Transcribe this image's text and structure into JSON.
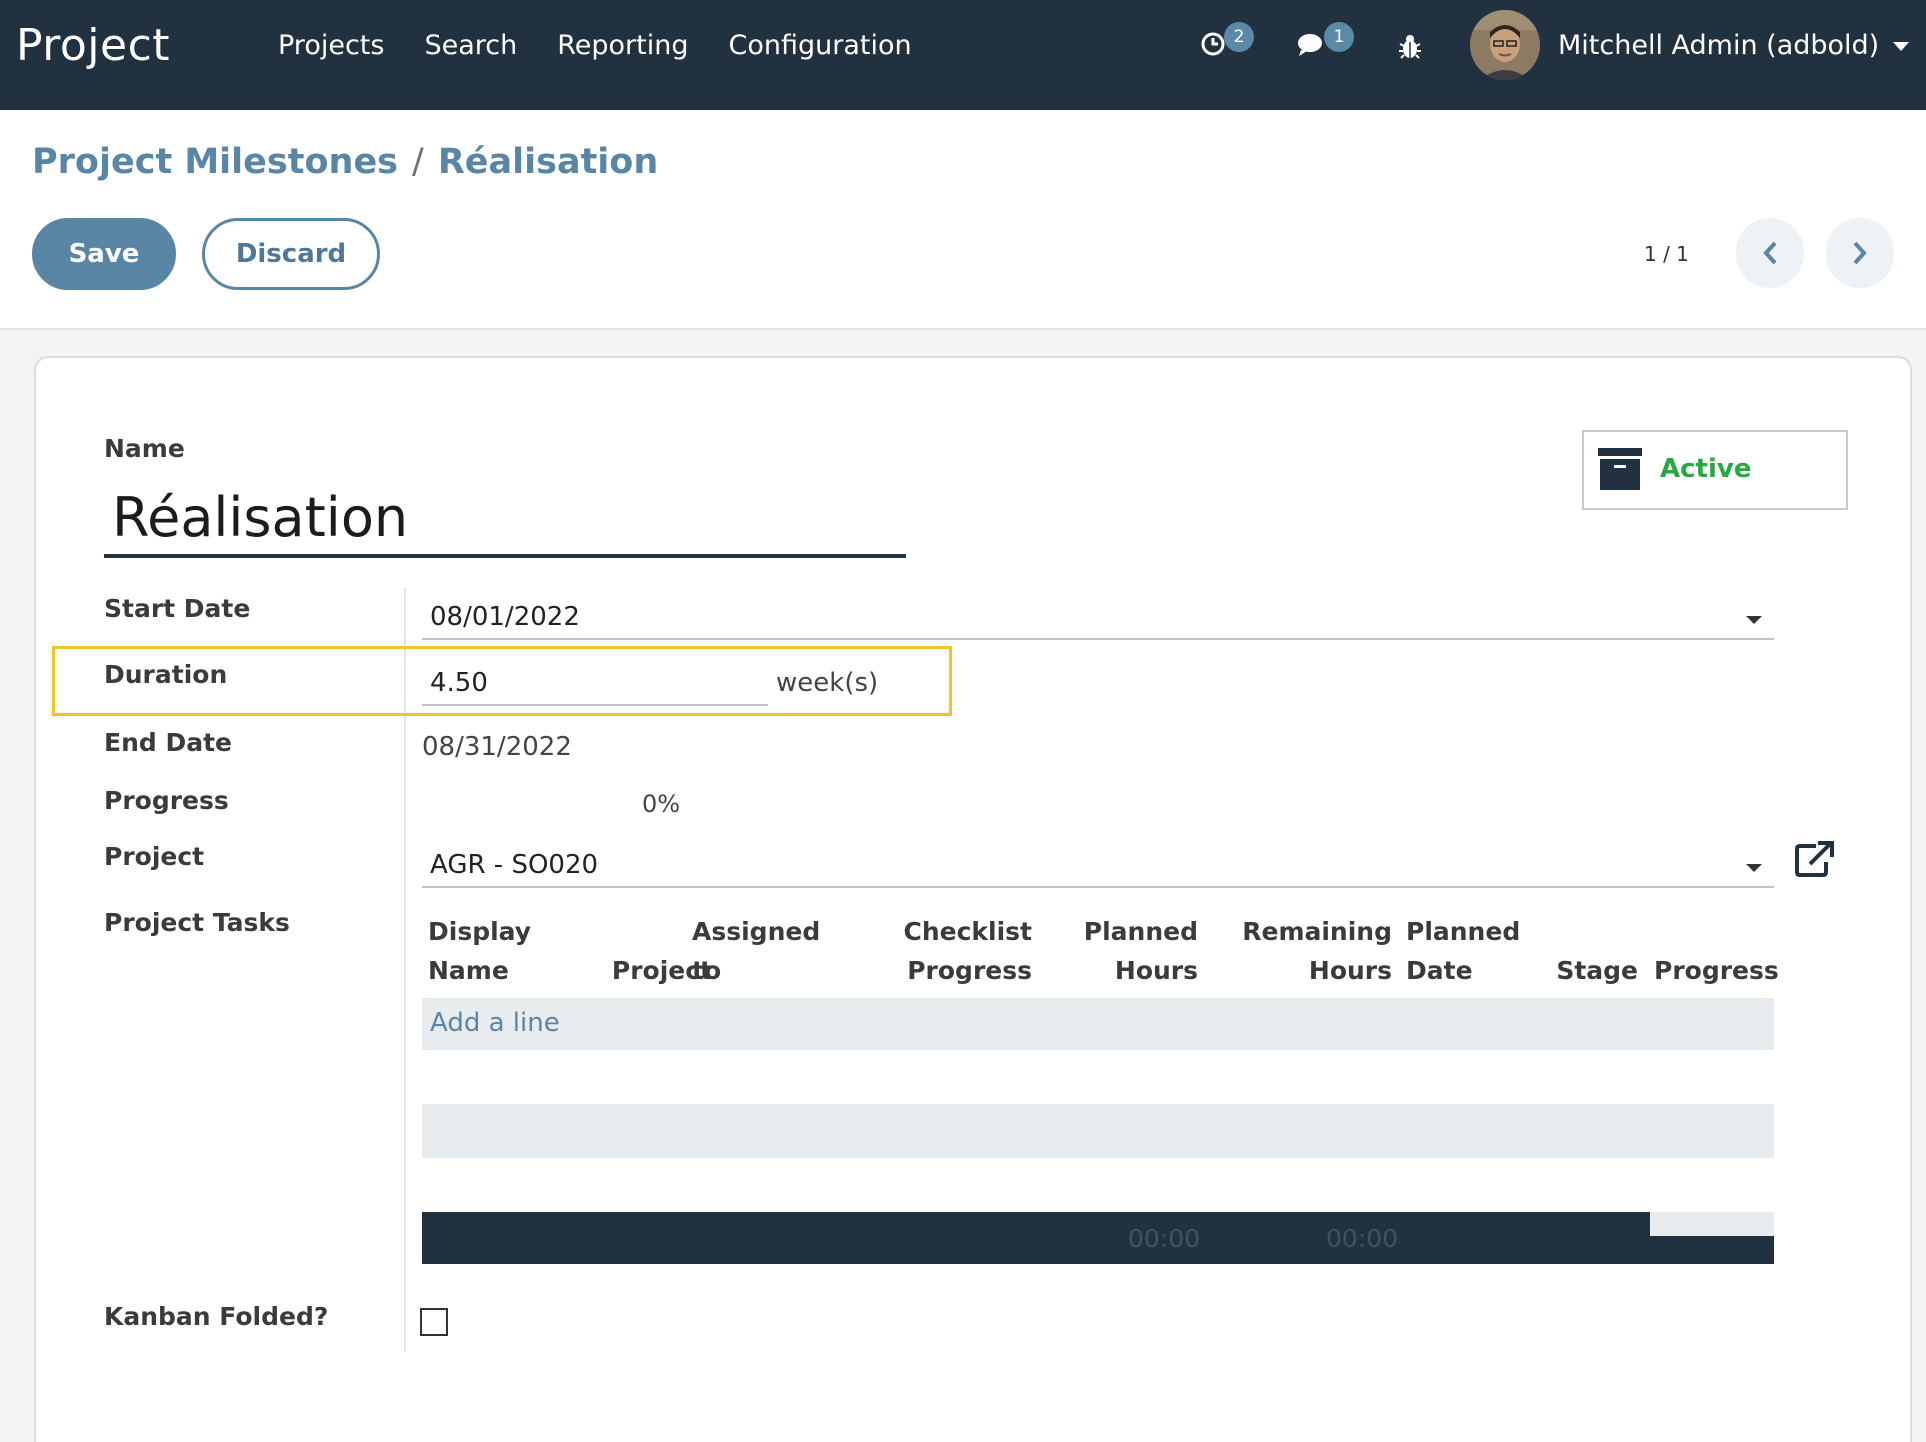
{
  "navbar": {
    "brand": "Project",
    "menu": [
      "Projects",
      "Search",
      "Reporting",
      "Configuration"
    ],
    "activity_count": "2",
    "messages_count": "1",
    "user_name": "Mitchell Admin (adbold)"
  },
  "breadcrumb": {
    "parent": "Project Milestones",
    "separator": "/",
    "current": "Réalisation"
  },
  "toolbar": {
    "save_label": "Save",
    "discard_label": "Discard",
    "pager": "1 / 1"
  },
  "form": {
    "name_label": "Name",
    "name_value": "Réalisation",
    "active_label": "Active",
    "start_date_label": "Start Date",
    "start_date_value": "08/01/2022",
    "duration_label": "Duration",
    "duration_value": "4.50",
    "duration_unit": "week(s)",
    "end_date_label": "End Date",
    "end_date_value": "08/31/2022",
    "progress_label": "Progress",
    "progress_value": "0%",
    "project_label": "Project",
    "project_value": "AGR - SO020",
    "tasks_label": "Project Tasks",
    "kanban_label": "Kanban Folded?",
    "kanban_checked": false
  },
  "tasks_table": {
    "headers": [
      [
        "Display",
        "Name"
      ],
      [
        "",
        "Project"
      ],
      [
        "Assigned",
        "to"
      ],
      [
        "Checklist",
        "Progress"
      ],
      [
        "Planned",
        "Hours"
      ],
      [
        "Remaining",
        "Hours"
      ],
      [
        "Planned",
        "Date"
      ],
      [
        "",
        "Stage"
      ],
      [
        "",
        "Progress"
      ]
    ],
    "add_line": "Add a line",
    "footer_planned_hours": "00:00",
    "footer_remaining_hours": "00:00"
  },
  "colors": {
    "navbar": "#223140",
    "accent": "#5a86a6",
    "active_green": "#28a745",
    "highlight": "#f2c42c"
  }
}
